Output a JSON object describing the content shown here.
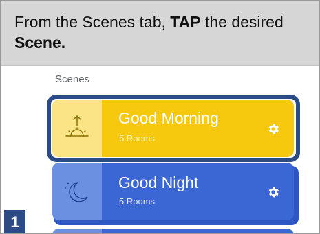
{
  "instruction": {
    "part1": "From the Scenes tab, ",
    "emphasis1": "TAP",
    "part2": " the desired ",
    "emphasis2": "Scene."
  },
  "scenes_label": "Scenes",
  "scenes": [
    {
      "title": "Good Morning",
      "subtitle": "5 Rooms",
      "icon": "sunrise-icon",
      "color": "#f6c90e",
      "selected": true
    },
    {
      "title": "Good Night",
      "subtitle": "5 Rooms",
      "icon": "moon-icon",
      "color": "#3a67d4",
      "selected": false
    }
  ],
  "step_number": "1",
  "colors": {
    "highlight_border": "#2b4a86",
    "instruction_bg": "#d6d6d6"
  }
}
